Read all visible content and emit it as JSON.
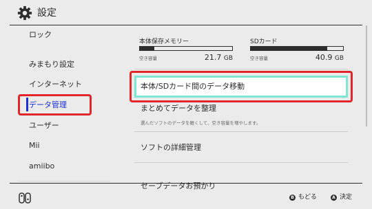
{
  "header": {
    "title": "設定",
    "icon": "gear-icon"
  },
  "sidebar": {
    "items": [
      {
        "label": "ロック"
      },
      {
        "label": "みまもり設定"
      },
      {
        "label": "インターネット"
      },
      {
        "label": "データ管理"
      },
      {
        "label": "ユーザー"
      },
      {
        "label": "Mii"
      },
      {
        "label": "amiibo"
      }
    ],
    "selected": "データ管理"
  },
  "storage": {
    "system": {
      "label": "本体保存メモリー",
      "free_label": "空き容量",
      "size": "21.7",
      "unit": "GB",
      "used_fraction": 0.16
    },
    "sd": {
      "label": "SDカード",
      "free_label": "空き容量",
      "size": "40.9",
      "unit": "GB",
      "used_fraction": 0.83
    }
  },
  "menu": {
    "move_data": "本体/SDカード間のデータ移動",
    "organize": "まとめてデータを整理",
    "organize_desc": "選んだソフトのデータを軽くして、空き容量を増やします。",
    "software_detail": "ソフトの詳細管理",
    "save_data": "セーブデータお預かり"
  },
  "footer": {
    "back": {
      "button": "B",
      "label": "もどる"
    },
    "confirm": {
      "button": "A",
      "label": "決定"
    }
  },
  "colors": {
    "background": "#ebebeb",
    "text": "#2d2d2d",
    "selected": "#1e2fd4",
    "focus": "#7fe6d2",
    "highlight": "#e0262a"
  }
}
